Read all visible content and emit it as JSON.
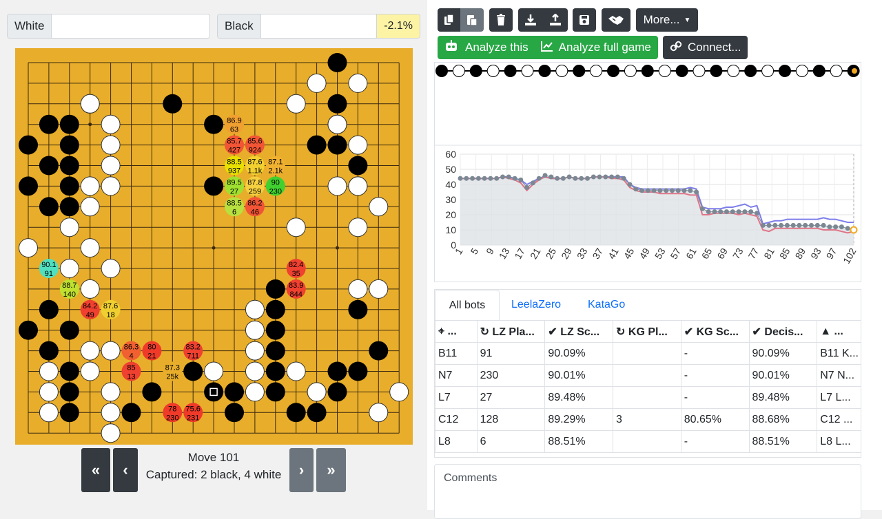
{
  "players": {
    "white_label": "White",
    "black_label": "Black",
    "white_name": "",
    "black_name": "",
    "winrate_delta": "-2.1%"
  },
  "board": {
    "size": 19,
    "black_stones": [
      [
        15,
        0
      ],
      [
        3,
        2
      ],
      [
        7,
        2
      ],
      [
        15,
        2
      ],
      [
        1,
        3
      ],
      [
        2,
        3
      ],
      [
        9,
        3
      ],
      [
        15,
        3
      ],
      [
        0,
        4
      ],
      [
        2,
        4
      ],
      [
        14,
        4
      ],
      [
        15,
        4
      ],
      [
        1,
        5
      ],
      [
        2,
        5
      ],
      [
        16,
        5
      ],
      [
        0,
        6
      ],
      [
        2,
        6
      ],
      [
        9,
        6
      ],
      [
        16,
        6
      ],
      [
        1,
        7
      ],
      [
        2,
        7
      ],
      [
        12,
        11
      ],
      [
        12,
        12
      ],
      [
        1,
        12
      ],
      [
        16,
        12
      ],
      [
        0,
        13
      ],
      [
        2,
        13
      ],
      [
        12,
        13
      ],
      [
        1,
        14
      ],
      [
        12,
        14
      ],
      [
        17,
        14
      ],
      [
        2,
        15
      ],
      [
        8,
        15
      ],
      [
        12,
        15
      ],
      [
        15,
        15
      ],
      [
        16,
        15
      ],
      [
        2,
        16
      ],
      [
        6,
        16
      ],
      [
        10,
        16
      ],
      [
        12,
        16
      ],
      [
        14,
        16
      ],
      [
        15,
        16
      ],
      [
        2,
        17
      ],
      [
        5,
        17
      ],
      [
        10,
        17
      ],
      [
        13,
        17
      ],
      [
        14,
        17
      ]
    ],
    "white_stones": [
      [
        14,
        1
      ],
      [
        16,
        1
      ],
      [
        3,
        2
      ],
      [
        13,
        2
      ],
      [
        4,
        3
      ],
      [
        15,
        3
      ],
      [
        4,
        4
      ],
      [
        16,
        4
      ],
      [
        4,
        5
      ],
      [
        3,
        6
      ],
      [
        4,
        6
      ],
      [
        15,
        6
      ],
      [
        16,
        6
      ],
      [
        3,
        7
      ],
      [
        17,
        7
      ],
      [
        2,
        8
      ],
      [
        13,
        8
      ],
      [
        16,
        8
      ],
      [
        0,
        9
      ],
      [
        3,
        9
      ],
      [
        2,
        10
      ],
      [
        4,
        10
      ],
      [
        3,
        11
      ],
      [
        16,
        11
      ],
      [
        17,
        11
      ],
      [
        11,
        12
      ],
      [
        11,
        13
      ],
      [
        11,
        14
      ],
      [
        3,
        14
      ],
      [
        4,
        14
      ],
      [
        11,
        15
      ],
      [
        1,
        15
      ],
      [
        3,
        15
      ],
      [
        9,
        15
      ],
      [
        13,
        15
      ],
      [
        1,
        16
      ],
      [
        4,
        16
      ],
      [
        11,
        16
      ],
      [
        14,
        16
      ],
      [
        1,
        17
      ],
      [
        4,
        17
      ],
      [
        18,
        16
      ],
      [
        17,
        17
      ],
      [
        4,
        18
      ]
    ],
    "last_move": [
      9,
      16
    ],
    "suggestions": [
      {
        "col": 10,
        "row": 3,
        "winrate": "86.9",
        "visits": "63",
        "color": "#f0a030"
      },
      {
        "col": 10,
        "row": 4,
        "winrate": "85.7",
        "visits": "427",
        "color": "#f15535"
      },
      {
        "col": 11,
        "row": 4,
        "winrate": "85.6",
        "visits": "924",
        "color": "#f15535"
      },
      {
        "col": 10,
        "row": 5,
        "winrate": "88.5",
        "visits": "937",
        "color": "#e8e000"
      },
      {
        "col": 11,
        "row": 5,
        "winrate": "87.6",
        "visits": "1.1k",
        "color": "#f2d030"
      },
      {
        "col": 12,
        "row": 5,
        "winrate": "87.1",
        "visits": "2.1k",
        "color": "#f0b030"
      },
      {
        "col": 10,
        "row": 6,
        "winrate": "89.5",
        "visits": "27",
        "color": "#a0e030"
      },
      {
        "col": 11,
        "row": 6,
        "winrate": "87.8",
        "visits": "259",
        "color": "#f5d040"
      },
      {
        "col": 12,
        "row": 6,
        "winrate": "90",
        "visits": "230",
        "color": "#40d030"
      },
      {
        "col": 10,
        "row": 7,
        "winrate": "88.5",
        "visits": "6",
        "color": "#b8e040"
      },
      {
        "col": 11,
        "row": 7,
        "winrate": "86.2",
        "visits": "46",
        "color": "#f15535"
      },
      {
        "col": 13,
        "row": 10,
        "winrate": "82.4",
        "visits": "35",
        "color": "#ef4030"
      },
      {
        "col": 13,
        "row": 11,
        "winrate": "83.9",
        "visits": "844",
        "color": "#ef4030"
      },
      {
        "col": 1,
        "row": 10,
        "winrate": "90.1",
        "visits": "91",
        "color": "#50e0c0"
      },
      {
        "col": 2,
        "row": 11,
        "winrate": "88.7",
        "visits": "140",
        "color": "#c0e030"
      },
      {
        "col": 3,
        "row": 12,
        "winrate": "84.2",
        "visits": "49",
        "color": "#ef4030"
      },
      {
        "col": 4,
        "row": 12,
        "winrate": "87.6",
        "visits": "18",
        "color": "#f0d030"
      },
      {
        "col": 5,
        "row": 14,
        "winrate": "86.3",
        "visits": "4",
        "color": "#f06030"
      },
      {
        "col": 6,
        "row": 14,
        "winrate": "80",
        "visits": "21",
        "color": "#ef3a2a"
      },
      {
        "col": 8,
        "row": 14,
        "winrate": "83.2",
        "visits": "711",
        "color": "#ef4030"
      },
      {
        "col": 5,
        "row": 15,
        "winrate": "85",
        "visits": "13",
        "color": "#ef4030"
      },
      {
        "col": 7,
        "row": 15,
        "winrate": "87.3",
        "visits": "25k",
        "color": "#e8ad2a"
      },
      {
        "col": 7,
        "row": 17,
        "winrate": "78",
        "visits": "230",
        "color": "#ef3a2a"
      },
      {
        "col": 8,
        "row": 17,
        "winrate": "75.6",
        "visits": "231",
        "color": "#ef3a2a"
      }
    ]
  },
  "navigation": {
    "first": "«",
    "prev": "‹",
    "next": "›",
    "last": "»",
    "move_label": "Move 101",
    "captured": "Captured: 2 black, 4 white"
  },
  "toolbar": {
    "copy_icon": "copy-icon",
    "paste_icon": "paste-icon",
    "delete_icon": "trash-icon",
    "download_icon": "download-icon",
    "upload_icon": "upload-icon",
    "save_icon": "save-icon",
    "handshake_icon": "handshake-icon",
    "more_label": "More...",
    "analyze_this": "Analyze this",
    "analyze_full": "Analyze full game",
    "connect": "Connect..."
  },
  "chart_data": {
    "type": "line",
    "y_ticks": [
      "60",
      "50",
      "40",
      "30",
      "20",
      "10",
      "0"
    ],
    "ylim": [
      0,
      60
    ],
    "x_ticks": [
      "1",
      "5",
      "9",
      "13",
      "17",
      "21",
      "25",
      "29",
      "33",
      "37",
      "41",
      "45",
      "49",
      "53",
      "57",
      "61",
      "65",
      "69",
      "73",
      "77",
      "81",
      "85",
      "89",
      "93",
      "97",
      "102"
    ],
    "xlim": [
      1,
      102
    ],
    "series": [
      {
        "color": "#7d7dea",
        "values": [
          44,
          44,
          44,
          44,
          44,
          44,
          44,
          45,
          45,
          44,
          43,
          40,
          42,
          44,
          45,
          44,
          44,
          44,
          45,
          44,
          44,
          44,
          45,
          45,
          45,
          45,
          45,
          45,
          40,
          38,
          37,
          37,
          37,
          37,
          37,
          37,
          37,
          37,
          38,
          37,
          25,
          24,
          24,
          24,
          25,
          25,
          26,
          27,
          25,
          26,
          14,
          15,
          16,
          16,
          17,
          17,
          17,
          17,
          17,
          17,
          18,
          17,
          17,
          16,
          15,
          15
        ]
      },
      {
        "color": "#e07488",
        "values": [
          44,
          44,
          44,
          44,
          44,
          44,
          44,
          45,
          44,
          43,
          41,
          36,
          40,
          43,
          45,
          44,
          44,
          44,
          45,
          44,
          44,
          44,
          45,
          45,
          45,
          44,
          44,
          43,
          38,
          36,
          35,
          35,
          35,
          34,
          34,
          34,
          34,
          34,
          33,
          33,
          20,
          20,
          21,
          21,
          21,
          21,
          20,
          21,
          20,
          19,
          10,
          9,
          11,
          11,
          11,
          11,
          11,
          11,
          11,
          11,
          10,
          10,
          10,
          9,
          8,
          9
        ]
      },
      {
        "color": "#7b8894",
        "values": [
          44,
          44,
          44,
          44,
          44,
          44,
          44,
          45,
          45,
          44,
          43,
          38,
          41,
          44,
          46,
          45,
          44,
          44,
          45,
          44,
          44,
          44,
          45,
          45,
          45,
          45,
          45,
          44,
          40,
          37,
          36,
          36,
          36,
          36,
          36,
          36,
          36,
          36,
          36,
          35,
          24,
          22,
          22,
          22,
          22,
          22,
          22,
          22,
          22,
          21,
          13,
          13,
          13,
          13,
          13,
          13,
          13,
          13,
          13,
          13,
          13,
          12,
          12,
          12,
          11,
          10
        ]
      }
    ],
    "move_strip": [
      "b",
      "w",
      "b",
      "w",
      "b",
      "w",
      "b",
      "w",
      "b",
      "w",
      "b",
      "w",
      "b",
      "w",
      "b",
      "w",
      "b",
      "w",
      "b",
      "w",
      "b",
      "w",
      "b",
      "w",
      "b"
    ]
  },
  "analysis_tabs": {
    "tabs": [
      "All bots",
      "LeelaZero",
      "KataGo"
    ],
    "headers": [
      "...",
      "LZ Pla...",
      "LZ Sc...",
      "KG Pl...",
      "KG Sc...",
      "Decis...",
      "..."
    ],
    "rows": [
      [
        "B11",
        "91",
        "90.09%",
        "",
        "-",
        "90.09%",
        "B11 K..."
      ],
      [
        "N7",
        "230",
        "90.01%",
        "",
        "-",
        "90.01%",
        "N7 N..."
      ],
      [
        "L7",
        "27",
        "89.48%",
        "",
        "-",
        "89.48%",
        "L7 L..."
      ],
      [
        "C12",
        "128",
        "89.29%",
        "3",
        "80.65%",
        "88.68%",
        "C12 ..."
      ],
      [
        "L8",
        "6",
        "88.51%",
        "",
        "-",
        "88.51%",
        "L8 L..."
      ]
    ]
  },
  "comments": {
    "label": "Comments"
  }
}
